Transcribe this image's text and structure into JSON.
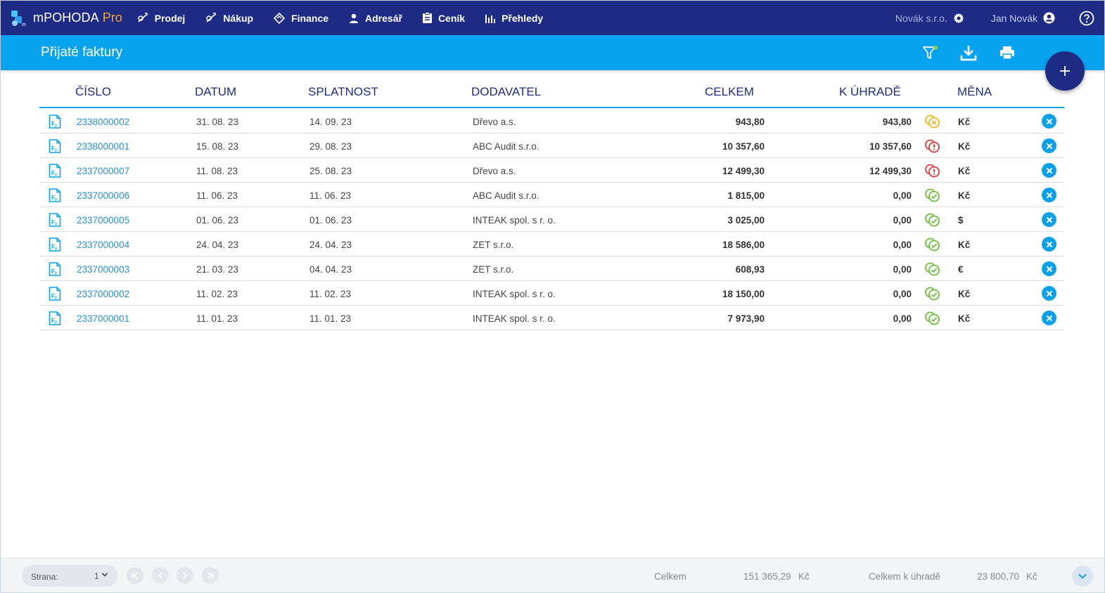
{
  "app": {
    "name": "mPOHODA",
    "edition": "Pro"
  },
  "nav": {
    "items": [
      {
        "label": "Prodej",
        "icon": "sales-icon"
      },
      {
        "label": "Nákup",
        "icon": "purchase-icon"
      },
      {
        "label": "Finance",
        "icon": "finance-icon"
      },
      {
        "label": "Adresář",
        "icon": "person-icon"
      },
      {
        "label": "Ceník",
        "icon": "clipboard-icon"
      },
      {
        "label": "Přehledy",
        "icon": "bar-chart-icon"
      }
    ],
    "company": "Novák s.r.o.",
    "user": "Jan Novák"
  },
  "page": {
    "title": "Přijaté faktury"
  },
  "table": {
    "headers": {
      "number": "ČÍSLO",
      "date": "DATUM",
      "due": "SPLATNOST",
      "supplier": "DODAVATEL",
      "total": "CELKEM",
      "to_pay": "K ÚHRADĚ",
      "currency": "MĚNA"
    },
    "rows": [
      {
        "number": "2338000002",
        "date": "31. 08. 23",
        "due": "14. 09. 23",
        "supplier": "Dřevo a.s.",
        "total": "943,80",
        "to_pay": "943,80",
        "status": "pending",
        "currency": "Kč"
      },
      {
        "number": "2338000001",
        "date": "15. 08. 23",
        "due": "29. 08. 23",
        "supplier": "ABC Audit s.r.o.",
        "total": "10 357,60",
        "to_pay": "10 357,60",
        "status": "overdue",
        "currency": "Kč"
      },
      {
        "number": "2337000007",
        "date": "11. 08. 23",
        "due": "25. 08. 23",
        "supplier": "Dřevo a.s.",
        "total": "12 499,30",
        "to_pay": "12 499,30",
        "status": "overdue",
        "currency": "Kč"
      },
      {
        "number": "2337000006",
        "date": "11. 06. 23",
        "due": "11. 06. 23",
        "supplier": "ABC Audit s.r.o.",
        "total": "1 815,00",
        "to_pay": "0,00",
        "status": "paid",
        "currency": "Kč"
      },
      {
        "number": "2337000005",
        "date": "01. 06. 23",
        "due": "01. 06. 23",
        "supplier": "INTEAK spol. s r. o.",
        "total": "3 025,00",
        "to_pay": "0,00",
        "status": "paid",
        "currency": "$"
      },
      {
        "number": "2337000004",
        "date": "24. 04. 23",
        "due": "24. 04. 23",
        "supplier": "ZET s.r.o.",
        "total": "18 586,00",
        "to_pay": "0,00",
        "status": "paid",
        "currency": "Kč"
      },
      {
        "number": "2337000003",
        "date": "21. 03. 23",
        "due": "04. 04. 23",
        "supplier": "ZET s.r.o.",
        "total": "608,93",
        "to_pay": "0,00",
        "status": "paid",
        "currency": "€"
      },
      {
        "number": "2337000002",
        "date": "11. 02. 23",
        "due": "11. 02. 23",
        "supplier": "INTEAK spol. s r. o.",
        "total": "18 150,00",
        "to_pay": "0,00",
        "status": "paid",
        "currency": "Kč"
      },
      {
        "number": "2337000001",
        "date": "11. 01. 23",
        "due": "11. 01. 23",
        "supplier": "INTEAK spol. s r. o.",
        "total": "7 973,90",
        "to_pay": "0,00",
        "status": "paid",
        "currency": "Kč"
      }
    ]
  },
  "footer": {
    "page_label": "Strana:",
    "page_value": "1",
    "total_label": "Celkem",
    "total_value": "151 365,29",
    "total_currency": "Kč",
    "to_pay_label": "Celkem k úhradě",
    "to_pay_value": "23 800,70",
    "to_pay_currency": "Kč"
  },
  "colors": {
    "nav_bg": "#1e2c86",
    "subheader_bg": "#08a3ef",
    "accent": "#0aa0ea",
    "status_paid": "#6cbf3c",
    "status_pending": "#f5b51f",
    "status_overdue": "#e53b3b",
    "brand_pro": "#f6a623"
  }
}
